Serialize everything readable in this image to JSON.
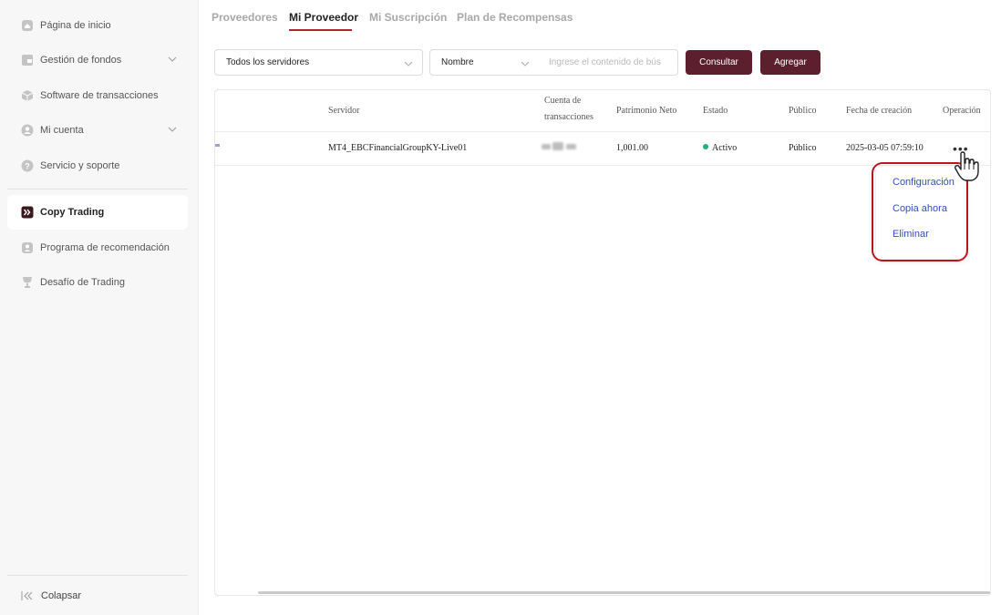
{
  "sidebar": {
    "items": [
      {
        "label": "Página de inicio",
        "icon": "home-icon"
      },
      {
        "label": "Gestión de fondos",
        "icon": "wallet-icon"
      },
      {
        "label": "Software de transacciones",
        "icon": "box-icon"
      },
      {
        "label": "Mi cuenta",
        "icon": "user-icon"
      },
      {
        "label": "Servicio y soporte",
        "icon": "help-icon"
      },
      {
        "label": "Copy Trading",
        "icon": "copy-trading-icon"
      },
      {
        "label": "Programa de recomendación",
        "icon": "referral-icon"
      },
      {
        "label": "Desafío de Trading",
        "icon": "trophy-icon"
      }
    ],
    "collapse_label": "Colapsar"
  },
  "tabs": [
    {
      "label": "Proveedores"
    },
    {
      "label": "Mi Proveedor"
    },
    {
      "label": "Mi Suscripción"
    },
    {
      "label": "Plan de Recompensas"
    }
  ],
  "filters": {
    "server_select": "Todos los servidores",
    "field_select": "Nombre",
    "search_placeholder": "Ingrese el contenido de bús",
    "query_button": "Consultar",
    "add_button": "Agregar"
  },
  "table": {
    "headers": {
      "server": "Servidor",
      "account_line1": "Cuenta de",
      "account_line2": "transacciones",
      "equity": "Patrimonio Neto",
      "status": "Estado",
      "public": "Público",
      "created": "Fecha de creación",
      "operation": "Operación"
    },
    "rows": [
      {
        "server": "MT4_EBCFinancialGroupKY-Live01",
        "equity": "1,001.00",
        "status": "Activo",
        "public": "Público",
        "created": "2025-03-05 07:59:10",
        "more": "•••"
      }
    ]
  },
  "menu": {
    "items": [
      {
        "label": "Configuración"
      },
      {
        "label": "Copia ahora"
      },
      {
        "label": "Eliminar"
      }
    ]
  },
  "colors": {
    "accent": "#5c1f2e",
    "tab_underline": "#b3262f",
    "status_active": "#22b07d",
    "menu_link": "#2f4fc4",
    "highlight": "#c0141c"
  }
}
